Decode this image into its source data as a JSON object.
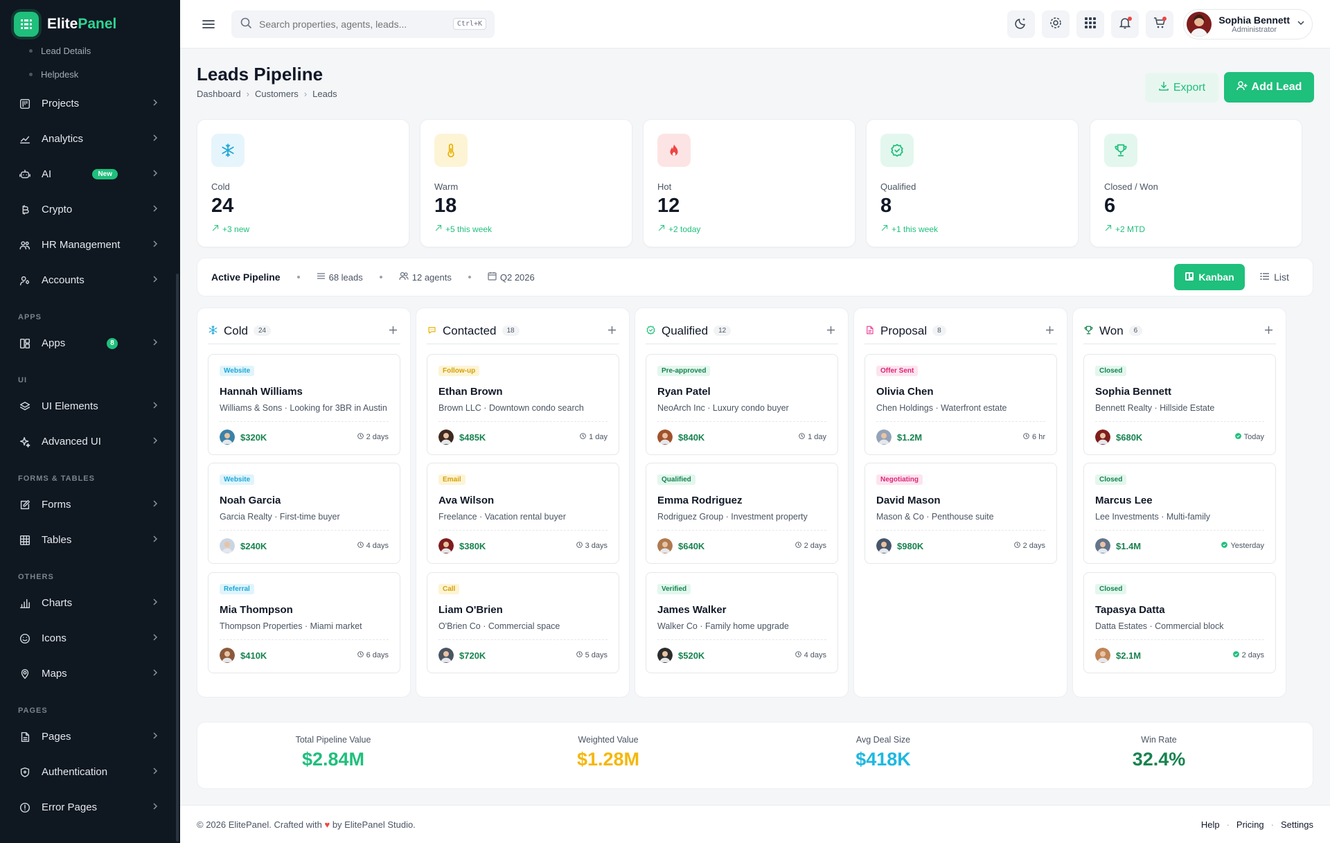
{
  "brand": {
    "name_main": "Elite",
    "name_accent": "Panel"
  },
  "sidebar": {
    "sub_items": [
      "Lead Details",
      "Helpdesk"
    ],
    "menu_main": [
      {
        "label": "Projects",
        "icon": "projects-icon"
      },
      {
        "label": "Analytics",
        "icon": "analytics-icon"
      },
      {
        "label": "AI",
        "icon": "ai-icon",
        "badge": "New"
      },
      {
        "label": "Crypto",
        "icon": "crypto-icon"
      },
      {
        "label": "HR Management",
        "icon": "hr-icon"
      },
      {
        "label": "Accounts",
        "icon": "accounts-icon"
      }
    ],
    "sections": {
      "apps": "APPS",
      "ui": "UI",
      "forms": "FORMS & TABLES",
      "others": "OTHERS",
      "pages": "PAGES"
    },
    "apps_items": [
      {
        "label": "Apps",
        "icon": "apps-icon",
        "count": "8"
      }
    ],
    "ui_items": [
      {
        "label": "UI Elements",
        "icon": "layers-icon"
      },
      {
        "label": "Advanced UI",
        "icon": "sparkle-icon"
      }
    ],
    "forms_items": [
      {
        "label": "Forms",
        "icon": "forms-icon"
      },
      {
        "label": "Tables",
        "icon": "tables-icon"
      }
    ],
    "others_items": [
      {
        "label": "Charts",
        "icon": "charts-icon"
      },
      {
        "label": "Icons",
        "icon": "smile-icon"
      },
      {
        "label": "Maps",
        "icon": "map-pin-icon"
      }
    ],
    "pages_items": [
      {
        "label": "Pages",
        "icon": "pages-icon"
      },
      {
        "label": "Authentication",
        "icon": "shield-icon"
      },
      {
        "label": "Error Pages",
        "icon": "alert-icon"
      }
    ]
  },
  "topbar": {
    "search_placeholder": "Search properties, agents, leads...",
    "search_shortcut": "Ctrl+K",
    "user_name": "Sophia Bennett",
    "user_role": "Administrator"
  },
  "page": {
    "title": "Leads Pipeline",
    "breadcrumb": [
      "Dashboard",
      "Customers",
      "Leads"
    ],
    "export_label": "Export",
    "add_label": "Add Lead"
  },
  "stats": [
    {
      "label": "Cold",
      "value": "24",
      "delta": "+3 new",
      "icon": "snowflake-icon",
      "bg": "#e6f5fc",
      "color": "#1ea7d8"
    },
    {
      "label": "Warm",
      "value": "18",
      "delta": "+5 this week",
      "icon": "thermometer-icon",
      "bg": "#fdf4d6",
      "color": "#eab308"
    },
    {
      "label": "Hot",
      "value": "12",
      "delta": "+2 today",
      "icon": "flame-icon",
      "bg": "#fde4e4",
      "color": "#ef4444"
    },
    {
      "label": "Qualified",
      "value": "8",
      "delta": "+1 this week",
      "icon": "badge-check-icon",
      "bg": "#e3f7ee",
      "color": "#1fbf7c"
    },
    {
      "label": "Closed / Won",
      "value": "6",
      "delta": "+2 MTD",
      "icon": "trophy-icon",
      "bg": "#e3f7ee",
      "color": "#1fbf7c"
    }
  ],
  "pipeline": {
    "title": "Active Pipeline",
    "leads": "68 leads",
    "agents": "12 agents",
    "quarter": "Q2 2026",
    "kanban_label": "Kanban",
    "list_label": "List"
  },
  "columns": [
    {
      "title": "Cold",
      "count": "24",
      "icon": "snowflake-icon",
      "color": "#1ea7d8",
      "cards": [
        {
          "tag": "Website",
          "tag_bg": "#e0f4fb",
          "tag_color": "#1ea7d8",
          "name": "Hannah Williams",
          "desc": "Williams & Sons · Looking for 3BR in Austin",
          "amount": "$320K",
          "time": "2 days",
          "time_icon": "clock-icon",
          "avatar": "#3b82a8"
        },
        {
          "tag": "Website",
          "tag_bg": "#e0f4fb",
          "tag_color": "#1ea7d8",
          "name": "Noah Garcia",
          "desc": "Garcia Realty · First-time buyer",
          "amount": "$240K",
          "time": "4 days",
          "time_icon": "clock-icon",
          "avatar": "#cbd5e1"
        },
        {
          "tag": "Referral",
          "tag_bg": "#e0f4fb",
          "tag_color": "#1ea7d8",
          "name": "Mia Thompson",
          "desc": "Thompson Properties · Miami market",
          "amount": "$410K",
          "time": "6 days",
          "time_icon": "clock-icon",
          "avatar": "#8b5a3c"
        }
      ]
    },
    {
      "title": "Contacted",
      "count": "18",
      "icon": "chat-icon",
      "color": "#eab308",
      "cards": [
        {
          "tag": "Follow-up",
          "tag_bg": "#fdf4d6",
          "tag_color": "#d4a106",
          "name": "Ethan Brown",
          "desc": "Brown LLC · Downtown condo search",
          "amount": "$485K",
          "time": "1 day",
          "time_icon": "clock-icon",
          "avatar": "#3f2a20"
        },
        {
          "tag": "Email",
          "tag_bg": "#fdf4d6",
          "tag_color": "#d4a106",
          "name": "Ava Wilson",
          "desc": "Freelance · Vacation rental buyer",
          "amount": "$380K",
          "time": "3 days",
          "time_icon": "clock-icon",
          "avatar": "#7f1d1d"
        },
        {
          "tag": "Call",
          "tag_bg": "#fdf4d6",
          "tag_color": "#d4a106",
          "name": "Liam O'Brien",
          "desc": "O'Brien Co · Commercial space",
          "amount": "$720K",
          "time": "5 days",
          "time_icon": "clock-icon",
          "avatar": "#4b5563"
        }
      ]
    },
    {
      "title": "Qualified",
      "count": "12",
      "icon": "badge-check-icon",
      "color": "#1fbf7c",
      "cards": [
        {
          "tag": "Pre-approved",
          "tag_bg": "#e3f7ee",
          "tag_color": "#17834f",
          "name": "Ryan Patel",
          "desc": "NeoArch Inc · Luxury condo buyer",
          "amount": "$840K",
          "time": "1 day",
          "time_icon": "clock-icon",
          "avatar": "#a0522d"
        },
        {
          "tag": "Qualified",
          "tag_bg": "#e3f7ee",
          "tag_color": "#17834f",
          "name": "Emma Rodriguez",
          "desc": "Rodriguez Group · Investment property",
          "amount": "$640K",
          "time": "2 days",
          "time_icon": "clock-icon",
          "avatar": "#b07a4f"
        },
        {
          "tag": "Verified",
          "tag_bg": "#e3f7ee",
          "tag_color": "#17834f",
          "name": "James Walker",
          "desc": "Walker Co · Family home upgrade",
          "amount": "$520K",
          "time": "4 days",
          "time_icon": "clock-icon",
          "avatar": "#2d2d2d"
        }
      ]
    },
    {
      "title": "Proposal",
      "count": "8",
      "icon": "document-icon",
      "color": "#ec4899",
      "cards": [
        {
          "tag": "Offer Sent",
          "tag_bg": "#fde4ef",
          "tag_color": "#db2777",
          "name": "Olivia Chen",
          "desc": "Chen Holdings · Waterfront estate",
          "amount": "$1.2M",
          "time": "6 hr",
          "time_icon": "clock-icon",
          "avatar": "#94a3b8"
        },
        {
          "tag": "Negotiating",
          "tag_bg": "#fde4ef",
          "tag_color": "#db2777",
          "name": "David Mason",
          "desc": "Mason & Co · Penthouse suite",
          "amount": "$980K",
          "time": "2 days",
          "time_icon": "clock-icon",
          "avatar": "#475569"
        }
      ]
    },
    {
      "title": "Won",
      "count": "6",
      "icon": "trophy-icon",
      "color": "#17834f",
      "cards": [
        {
          "tag": "Closed",
          "tag_bg": "#e3f7ee",
          "tag_color": "#17834f",
          "name": "Sophia Bennett",
          "desc": "Bennett Realty · Hillside Estate",
          "amount": "$680K",
          "time": "Today",
          "time_icon": "check-circle-icon",
          "avatar": "#7f1d1d"
        },
        {
          "tag": "Closed",
          "tag_bg": "#e3f7ee",
          "tag_color": "#17834f",
          "name": "Marcus Lee",
          "desc": "Lee Investments · Multi-family",
          "amount": "$1.4M",
          "time": "Yesterday",
          "time_icon": "check-circle-icon",
          "avatar": "#64748b"
        },
        {
          "tag": "Closed",
          "tag_bg": "#e3f7ee",
          "tag_color": "#17834f",
          "name": "Tapasya Datta",
          "desc": "Datta Estates · Commercial block",
          "amount": "$2.1M",
          "time": "2 days",
          "time_icon": "check-circle-icon",
          "avatar": "#c08457"
        }
      ]
    }
  ],
  "summary": [
    {
      "label": "Total Pipeline Value",
      "value": "$2.84M",
      "color": "#1fbf7c"
    },
    {
      "label": "Weighted Value",
      "value": "$1.28M",
      "color": "#f5b70a"
    },
    {
      "label": "Avg Deal Size",
      "value": "$418K",
      "color": "#1eb8e0"
    },
    {
      "label": "Win Rate",
      "value": "32.4%",
      "color": "#17834f"
    }
  ],
  "footer": {
    "copyright_pre": "© 2026 ElitePanel. Crafted with",
    "copyright_post": "by ElitePanel Studio.",
    "links": [
      "Help",
      "Pricing",
      "Settings"
    ]
  }
}
